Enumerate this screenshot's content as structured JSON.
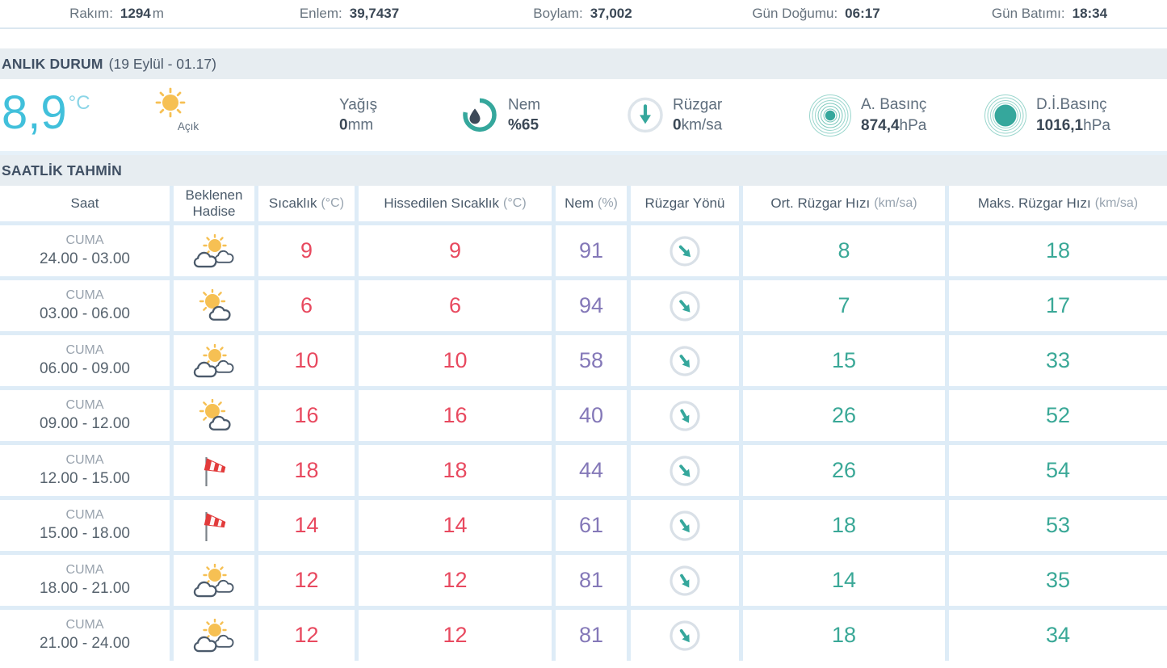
{
  "topbar": {
    "items": [
      {
        "label": "Rakım:",
        "value": "1294",
        "unit": "m"
      },
      {
        "label": "Enlem:",
        "value": "39,7437",
        "unit": ""
      },
      {
        "label": "Boylam:",
        "value": "37,002",
        "unit": ""
      },
      {
        "label": "Gün Doğumu:",
        "value": "06:17",
        "unit": ""
      },
      {
        "label": "Gün Batımı:",
        "value": "18:34",
        "unit": ""
      }
    ]
  },
  "current": {
    "section_title": "ANLIK DURUM",
    "section_date": "(19 Eylül - 01.17)",
    "temperature": "8,9",
    "temperature_unit": "°C",
    "condition_label": "Açık",
    "condition_icon": "sun",
    "metrics": [
      {
        "label": "Yağış",
        "icon": "",
        "value_prefix": "",
        "value": "0",
        "unit": "mm"
      },
      {
        "label": "Nem",
        "icon": "humidity-gauge",
        "value_prefix": "%",
        "value": "65",
        "unit": ""
      },
      {
        "label": "Rüzgar",
        "icon": "wind-circle",
        "value_prefix": "",
        "value": "0",
        "unit": "km/sa"
      },
      {
        "label": "A. Basınç",
        "icon": "pressure-station",
        "value_prefix": "",
        "value": "874,4",
        "unit": "hPa"
      },
      {
        "label": "D.İ.Basınç",
        "icon": "pressure-sea",
        "value_prefix": "",
        "value": "1016,1",
        "unit": "hPa"
      }
    ]
  },
  "forecast": {
    "section_title": "SAATLİK TAHMİN",
    "columns": [
      {
        "label": "Saat",
        "unit": ""
      },
      {
        "label": "Beklenen Hadise",
        "unit": ""
      },
      {
        "label": "Sıcaklık",
        "unit": "(°C)"
      },
      {
        "label": "Hissedilen Sıcaklık",
        "unit": "(°C)"
      },
      {
        "label": "Nem",
        "unit": "(%)"
      },
      {
        "label": "Rüzgar Yönü",
        "unit": ""
      },
      {
        "label": "Ort. Rüzgar Hızı",
        "unit": "(km/sa)"
      },
      {
        "label": "Maks. Rüzgar Hızı",
        "unit": "(km/sa)"
      }
    ],
    "rows": [
      {
        "day": "CUMA",
        "time": "24.00 - 03.00",
        "icon": "sun-two-clouds",
        "temp": "9",
        "feels": "9",
        "humidity": "91",
        "wind_dir_deg": 135,
        "avg_wind": "8",
        "max_wind": "18"
      },
      {
        "day": "CUMA",
        "time": "03.00 - 06.00",
        "icon": "sun-one-cloud",
        "temp": "6",
        "feels": "6",
        "humidity": "94",
        "wind_dir_deg": 140,
        "avg_wind": "7",
        "max_wind": "17"
      },
      {
        "day": "CUMA",
        "time": "06.00 - 09.00",
        "icon": "sun-two-clouds",
        "temp": "10",
        "feels": "10",
        "humidity": "58",
        "wind_dir_deg": 143,
        "avg_wind": "15",
        "max_wind": "33"
      },
      {
        "day": "CUMA",
        "time": "09.00 - 12.00",
        "icon": "sun-one-cloud",
        "temp": "16",
        "feels": "16",
        "humidity": "40",
        "wind_dir_deg": 150,
        "avg_wind": "26",
        "max_wind": "52"
      },
      {
        "day": "CUMA",
        "time": "12.00 - 15.00",
        "icon": "windsock",
        "temp": "18",
        "feels": "18",
        "humidity": "44",
        "wind_dir_deg": 140,
        "avg_wind": "26",
        "max_wind": "54"
      },
      {
        "day": "CUMA",
        "time": "15.00 - 18.00",
        "icon": "windsock",
        "temp": "14",
        "feels": "14",
        "humidity": "61",
        "wind_dir_deg": 145,
        "avg_wind": "18",
        "max_wind": "53"
      },
      {
        "day": "CUMA",
        "time": "18.00 - 21.00",
        "icon": "sun-two-clouds",
        "temp": "12",
        "feels": "12",
        "humidity": "81",
        "wind_dir_deg": 148,
        "avg_wind": "14",
        "max_wind": "35"
      },
      {
        "day": "CUMA",
        "time": "21.00 - 24.00",
        "icon": "sun-two-clouds",
        "temp": "12",
        "feels": "12",
        "humidity": "81",
        "wind_dir_deg": 145,
        "avg_wind": "18",
        "max_wind": "34"
      }
    ]
  },
  "colors": {
    "accent_teal": "#35a79c",
    "temp_cyan": "#41c0db",
    "temp_red": "#e8495f",
    "humidity_purple": "#8478b8",
    "wind_teal": "#3aa897",
    "sun_yellow": "#f6c053",
    "windsock_red": "#e23b3b",
    "section_bar_bg": "#e7edf1",
    "grid_gap_bg": "#deecf7"
  }
}
